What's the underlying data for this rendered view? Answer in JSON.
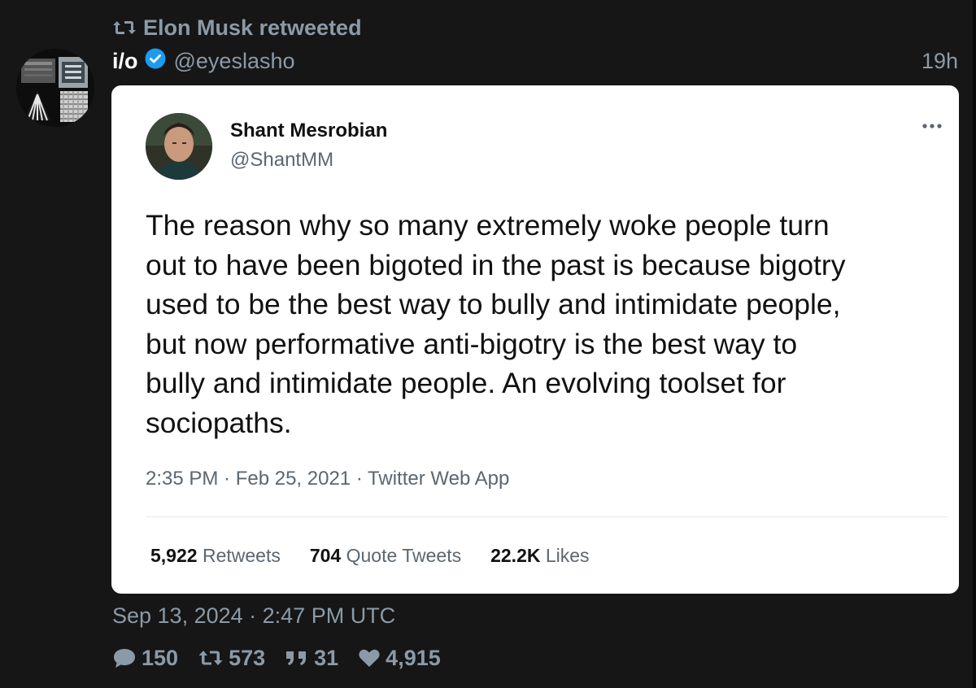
{
  "retweet_header": {
    "text": "Elon Musk retweeted",
    "icon": "retweet-icon"
  },
  "author": {
    "name": "i/o",
    "handle": "@eyeslasho",
    "verified": true,
    "age": "19h"
  },
  "quoted_image": {
    "author_name": "Shant Mesrobian",
    "author_handle": "@ShantMM",
    "text": "The reason why so many extremely woke people turn\nout to have been bigoted in the past is because bigotry\nused to be the best way to bully and intimidate people,\nbut now performative anti-bigotry is the best way to\nbully and intimidate people. An evolving toolset for\nsociopaths.",
    "meta": "2:35 PM · Feb 25, 2021 · Twitter Web App",
    "stats": [
      {
        "value": "5,922",
        "label": "Retweets"
      },
      {
        "value": "704",
        "label": "Quote Tweets"
      },
      {
        "value": "22.2K",
        "label": "Likes"
      }
    ]
  },
  "post_date": "Sep 13, 2024 · 2:47 PM UTC",
  "actions": {
    "comments": "150",
    "retweets": "573",
    "quotes": "31",
    "likes": "4,915"
  },
  "colors": {
    "background": "#161616",
    "muted": "#8b9aa7",
    "verified": "#1d9bf0",
    "card": "#ffffff"
  }
}
